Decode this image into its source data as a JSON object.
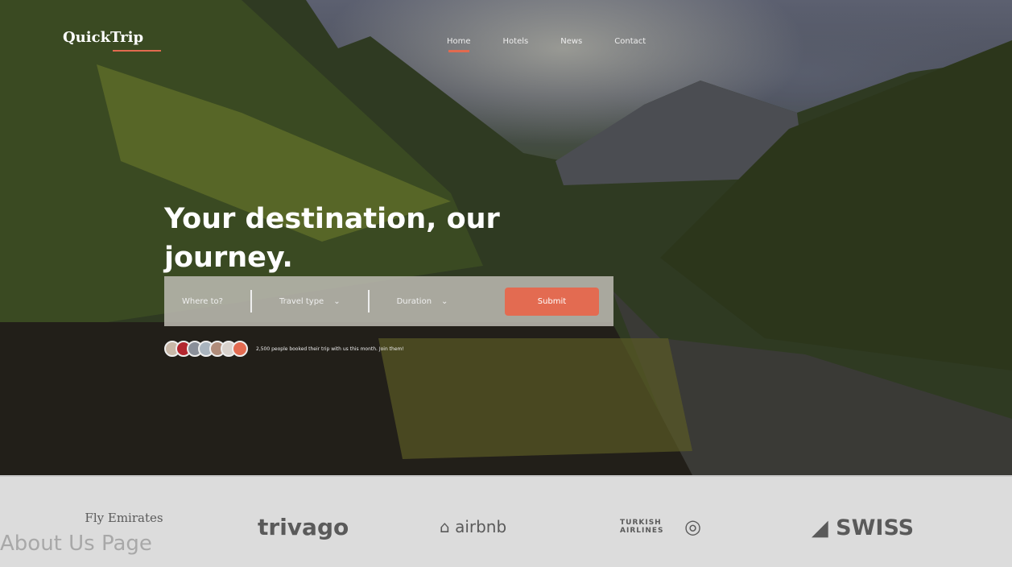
{
  "brand": {
    "name": "QuickTrip"
  },
  "nav": [
    {
      "label": "Home",
      "active": true
    },
    {
      "label": "Hotels"
    },
    {
      "label": "News"
    },
    {
      "label": "Contact"
    }
  ],
  "hero": {
    "title": "Your destination, our journey."
  },
  "search": {
    "where_placeholder": "Where to?",
    "travel_type": "Travel type",
    "duration": "Duration",
    "submit": "Submit"
  },
  "social_proof": {
    "text": "2,500 people booked their trip with us this month. Join them!"
  },
  "partners": [
    "Fly Emirates",
    "trivago",
    "airbnb",
    "TURKISH AIRLINES",
    "SWISS"
  ],
  "footer_label": "About Us Page",
  "colors": {
    "accent": "#e36b51"
  }
}
